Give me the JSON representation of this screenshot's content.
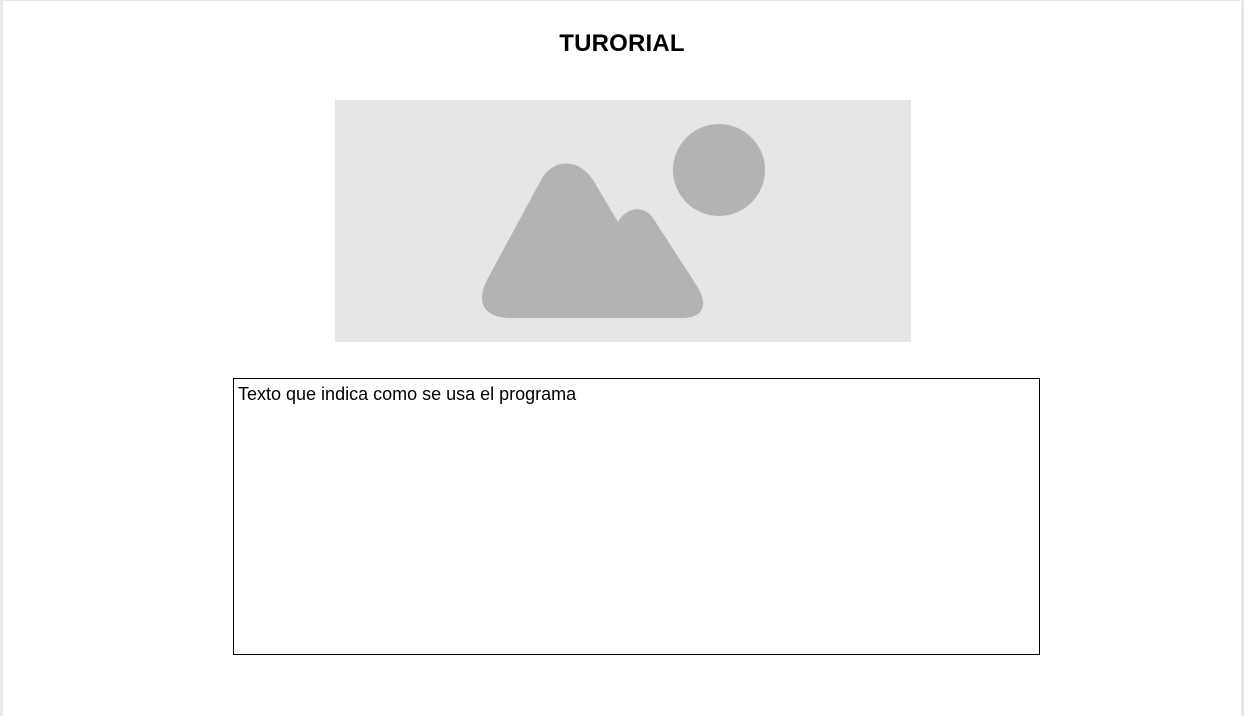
{
  "page": {
    "title": "TURORIAL"
  },
  "image": {
    "icon": "image-placeholder-icon",
    "background_color": "#e6e6e6",
    "shape_color": "#b3b3b3"
  },
  "text_panel": {
    "content": "Texto que indica como se usa el programa"
  }
}
